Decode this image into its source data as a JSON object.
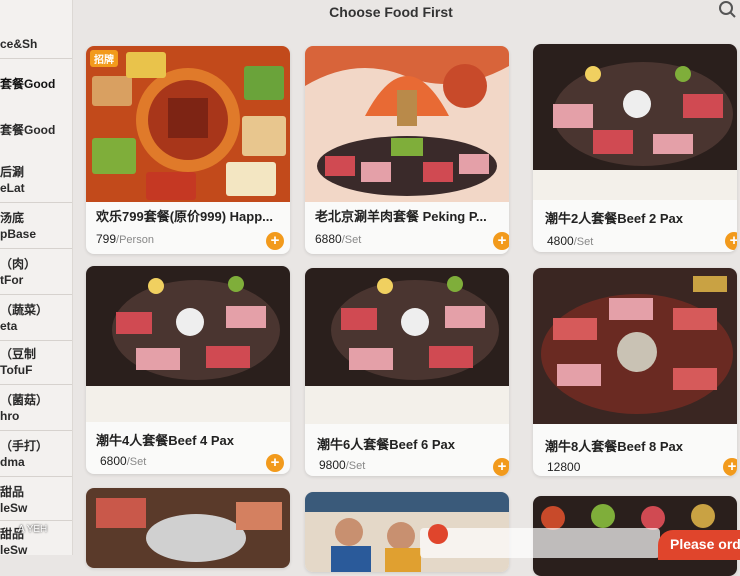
{
  "header": {
    "title": "Choose Food First"
  },
  "sidebar": {
    "items": [
      {
        "lines": [
          "ce&Sh"
        ]
      },
      {
        "lines": [
          "套餐Good"
        ]
      },
      {
        "lines": [
          "套餐Good"
        ]
      },
      {
        "lines": [
          "后涮",
          "eLat"
        ]
      },
      {
        "lines": [
          "汤底",
          "pBase"
        ]
      },
      {
        "lines": [
          "（肉）",
          "tFor"
        ]
      },
      {
        "lines": [
          "（蔬菜）",
          "eta"
        ]
      },
      {
        "lines": [
          "（豆制",
          "TofuF"
        ]
      },
      {
        "lines": [
          "（菌菇）",
          "hro"
        ]
      },
      {
        "lines": [
          "（手打）",
          "dma"
        ]
      },
      {
        "lines": [
          "甜品",
          "leSw"
        ]
      },
      {
        "lines": [
          "甜品",
          "leSw"
        ]
      }
    ]
  },
  "cards": [
    {
      "name": "欢乐799套餐(原价999) Happ...",
      "price": "799",
      "unit": "/Person",
      "badge": "招牌"
    },
    {
      "name": "老北京涮羊肉套餐 Peking P...",
      "price": "6880",
      "unit": "/Set"
    },
    {
      "name": "潮牛2人套餐Beef 2 Pax",
      "price": "4800",
      "unit": "/Set"
    },
    {
      "name": "潮牛4人套餐Beef 4 Pax",
      "price": "6800",
      "unit": "/Set"
    },
    {
      "name": "潮牛6人套餐Beef 6 Pax",
      "price": "9800",
      "unit": "/Set"
    },
    {
      "name": "潮牛8人套餐Beef 8 Pax",
      "price": "12800",
      "unit": "/Set"
    }
  ],
  "footer": {
    "checkout_label": "Please ord"
  },
  "watermark": "A YEH",
  "icons": {
    "search": "search-icon",
    "add": "plus-icon"
  },
  "colors": {
    "accent": "#f29a1c",
    "checkout": "#e0452c"
  }
}
